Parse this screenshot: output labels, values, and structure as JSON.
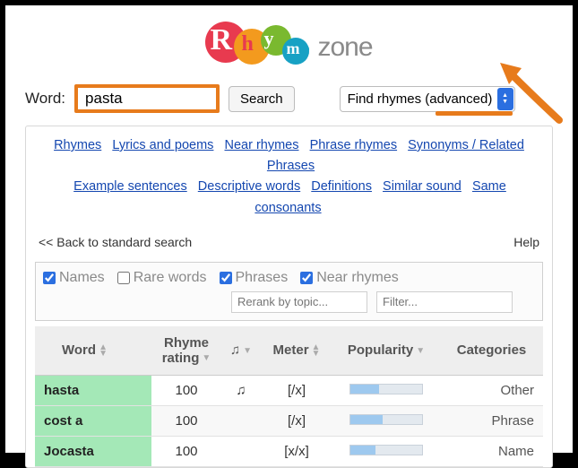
{
  "brand": {
    "zone": "zone"
  },
  "search": {
    "label": "Word:",
    "value": "pasta",
    "button": "Search",
    "dropdown": "Find rhymes (advanced)"
  },
  "nav": {
    "links1": [
      "Rhymes",
      "Lyrics and poems",
      "Near rhymes",
      "Phrase rhymes",
      "Synonyms / Related",
      "Phrases"
    ],
    "links2": [
      "Example sentences",
      "Descriptive words",
      "Definitions",
      "Similar sound",
      "Same consonants"
    ]
  },
  "sub": {
    "back": "<< Back to standard search",
    "help": "Help"
  },
  "filters": {
    "names": "Names",
    "rare": "Rare words",
    "phrases": "Phrases",
    "near": "Near rhymes",
    "rerank_ph": "Rerank by topic...",
    "filter_ph": "Filter..."
  },
  "headers": {
    "word": "Word",
    "rating": "Rhyme rating",
    "music": "♫",
    "meter": "Meter",
    "pop": "Popularity",
    "cat": "Categories"
  },
  "rows": [
    {
      "word": "hasta",
      "rating": "100",
      "music": "♫",
      "meter": "[/x]",
      "pop": 40,
      "cat": "Other"
    },
    {
      "word": "cost a",
      "rating": "100",
      "music": "",
      "meter": "[/x]",
      "pop": 45,
      "cat": "Phrase"
    },
    {
      "word": "Jocasta",
      "rating": "100",
      "music": "",
      "meter": "[x/x]",
      "pop": 35,
      "cat": "Name"
    }
  ]
}
